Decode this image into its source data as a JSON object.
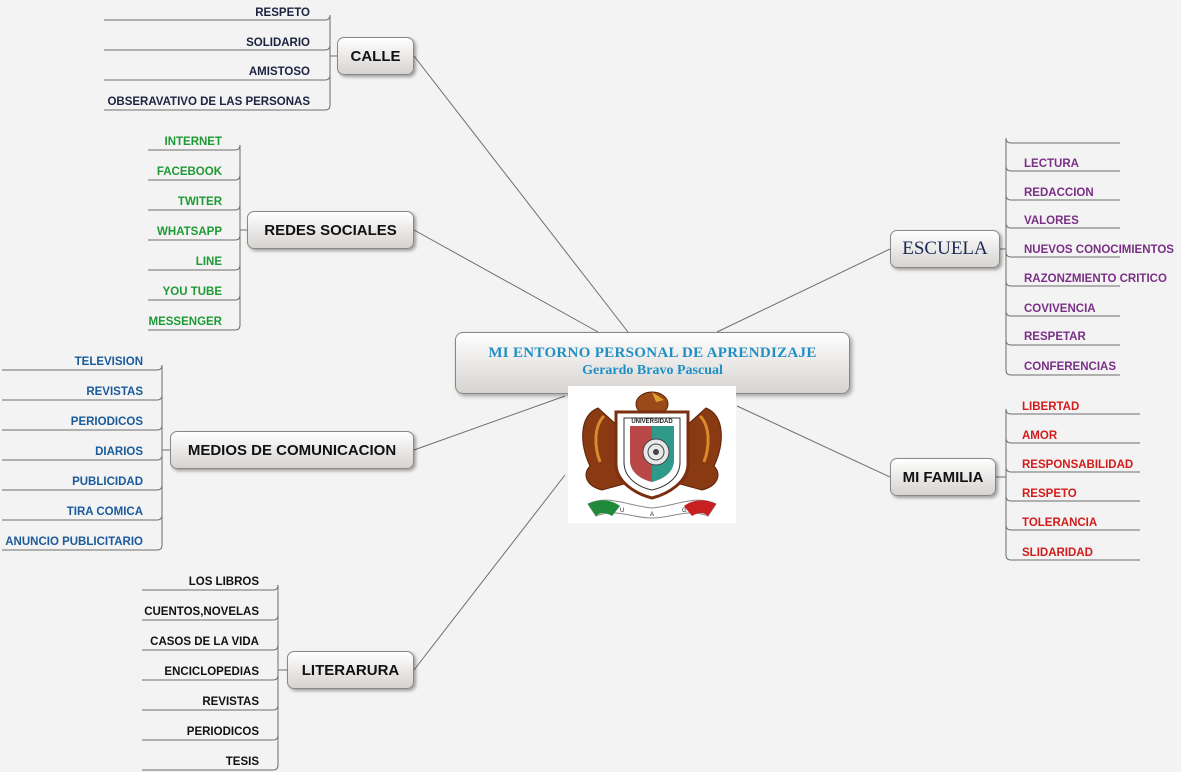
{
  "center": {
    "title": "MI  ENTORNO PERSONAL DE APRENDIZAJE",
    "subtitle": "Gerardo Bravo Pascual"
  },
  "logo": {
    "ring_text": "UNIVERSIDAD AUTONOMA DE GUERRERO",
    "letters": [
      "U",
      "A",
      "G"
    ]
  },
  "colors": {
    "calle": "#1b2340",
    "redes": "#1e9a35",
    "medios": "#1a5a9a",
    "literatura": "#111111",
    "escuela": "#7a2f86",
    "familia": "#d41b1b",
    "line": "#6e6e6e"
  },
  "branches": {
    "calle": {
      "label": "CALLE",
      "items": [
        "RESPETO",
        "SOLIDARIO",
        "AMISTOSO",
        "OBSERAVATIVO DE LAS PERSONAS"
      ]
    },
    "redes": {
      "label": "REDES SOCIALES",
      "items": [
        "INTERNET",
        "FACEBOOK",
        "TWITER",
        "WHATSAPP",
        "LINE",
        "YOU TUBE",
        "MESSENGER"
      ]
    },
    "medios": {
      "label": "MEDIOS DE COMUNICACION",
      "items": [
        "TELEVISION",
        "REVISTAS",
        "PERIODICOS",
        "DIARIOS",
        "PUBLICIDAD",
        "TIRA COMICA",
        "ANUNCIO PUBLICITARIO"
      ]
    },
    "literatura": {
      "label": "LITERARURA",
      "items": [
        "LOS LIBROS",
        "CUENTOS,NOVELAS",
        "CASOS DE LA VIDA",
        "ENCICLOPEDIAS",
        "REVISTAS",
        "PERIODICOS",
        "TESIS"
      ]
    },
    "escuela": {
      "label": "ESCUELA",
      "items": [
        "LECTURA",
        "REDACCION",
        "VALORES",
        "NUEVOS CONOCIMIENTOS",
        "RAZONZMIENTO CRITICO",
        "COVIVENCIA",
        "RESPETAR",
        "CONFERENCIAS"
      ]
    },
    "familia": {
      "label": "MI FAMILIA",
      "items": [
        "LIBERTAD",
        "AMOR",
        "RESPONSABILIDAD",
        "RESPETO",
        "TOLERANCIA",
        "SLIDARIDAD"
      ]
    }
  }
}
